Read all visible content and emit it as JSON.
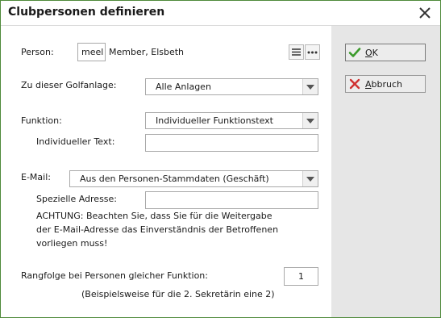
{
  "window": {
    "title": "Clubpersonen definieren"
  },
  "form": {
    "person_label": "Person:",
    "person_code": "meel",
    "person_name": "Member, Elsbeth",
    "golfanlage_label": "Zu dieser Golfanlage:",
    "golfanlage_value": "Alle Anlagen",
    "funktion_label": "Funktion:",
    "funktion_value": "Individueller Funktionstext",
    "indiv_text_label": "Individueller Text:",
    "indiv_text_value": "",
    "email_label": "E-Mail:",
    "email_value": "Aus den Personen-Stammdaten (Geschäft)",
    "spez_adresse_label": "Spezielle Adresse:",
    "spez_adresse_value": "",
    "warning_line1": "ACHTUNG: Beachten Sie, dass Sie für die Weitergabe",
    "warning_line2": "der E-Mail-Adresse das Einverständnis der Betroffenen",
    "warning_line3": "vorliegen muss!",
    "rangfolge_label": "Rangfolge bei Personen gleicher Funktion:",
    "rangfolge_value": "1",
    "rangfolge_hint": "(Beispielsweise für die 2. Sekretärin eine 2)"
  },
  "buttons": {
    "ok_label_u": "O",
    "ok_label_rest": "K",
    "cancel_label_u": "A",
    "cancel_label_rest": "bbruch"
  },
  "colors": {
    "ok_check": "#3a9a2a",
    "cancel_x": "#d03030",
    "window_border": "#4f8a3a"
  }
}
